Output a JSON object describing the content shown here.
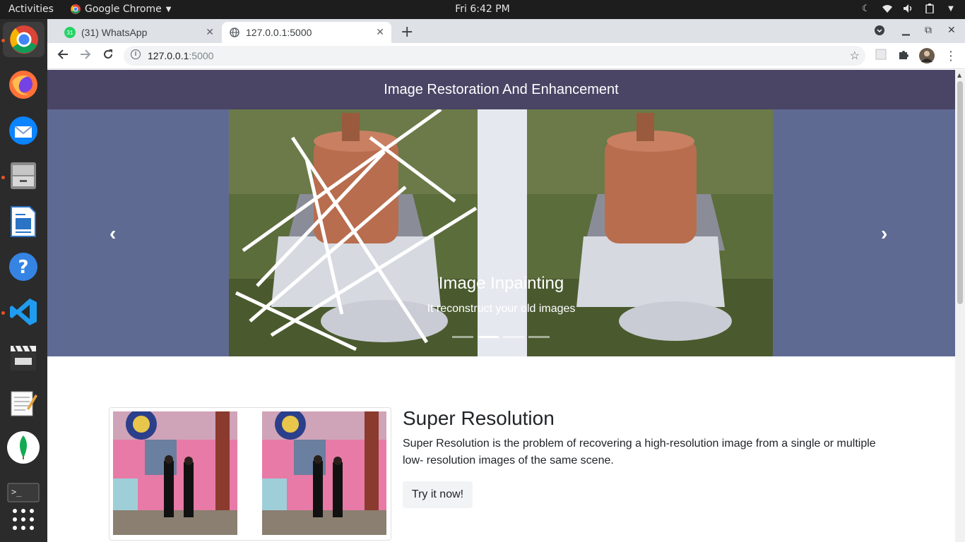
{
  "topbar": {
    "activities": "Activities",
    "app_name": "Google Chrome",
    "clock": "Fri  6:42 PM"
  },
  "browser": {
    "tabs": [
      {
        "label": "(31) WhatsApp",
        "badge": "31"
      },
      {
        "label": "127.0.0.1:5000"
      }
    ],
    "url_host": "127.0.0.1",
    "url_port": ":5000"
  },
  "page": {
    "navbar_title": "Image Restoration And Enhancement",
    "carousel": {
      "caption_title": "Image Inpainting",
      "caption_subtitle": "It reconstruct your old images",
      "prev": "‹",
      "next": "›",
      "indicators": 4,
      "active_indicator": 1
    },
    "feature": {
      "title": "Super Resolution",
      "description": "Super Resolution is the problem of recovering a high-resolution image from a single or multiple low- resolution images of the same scene.",
      "button": "Try it now!"
    }
  },
  "colors": {
    "navbar": "#4a4465",
    "carousel_bg": "#5f6a93",
    "dock_accent": "#e95420"
  }
}
